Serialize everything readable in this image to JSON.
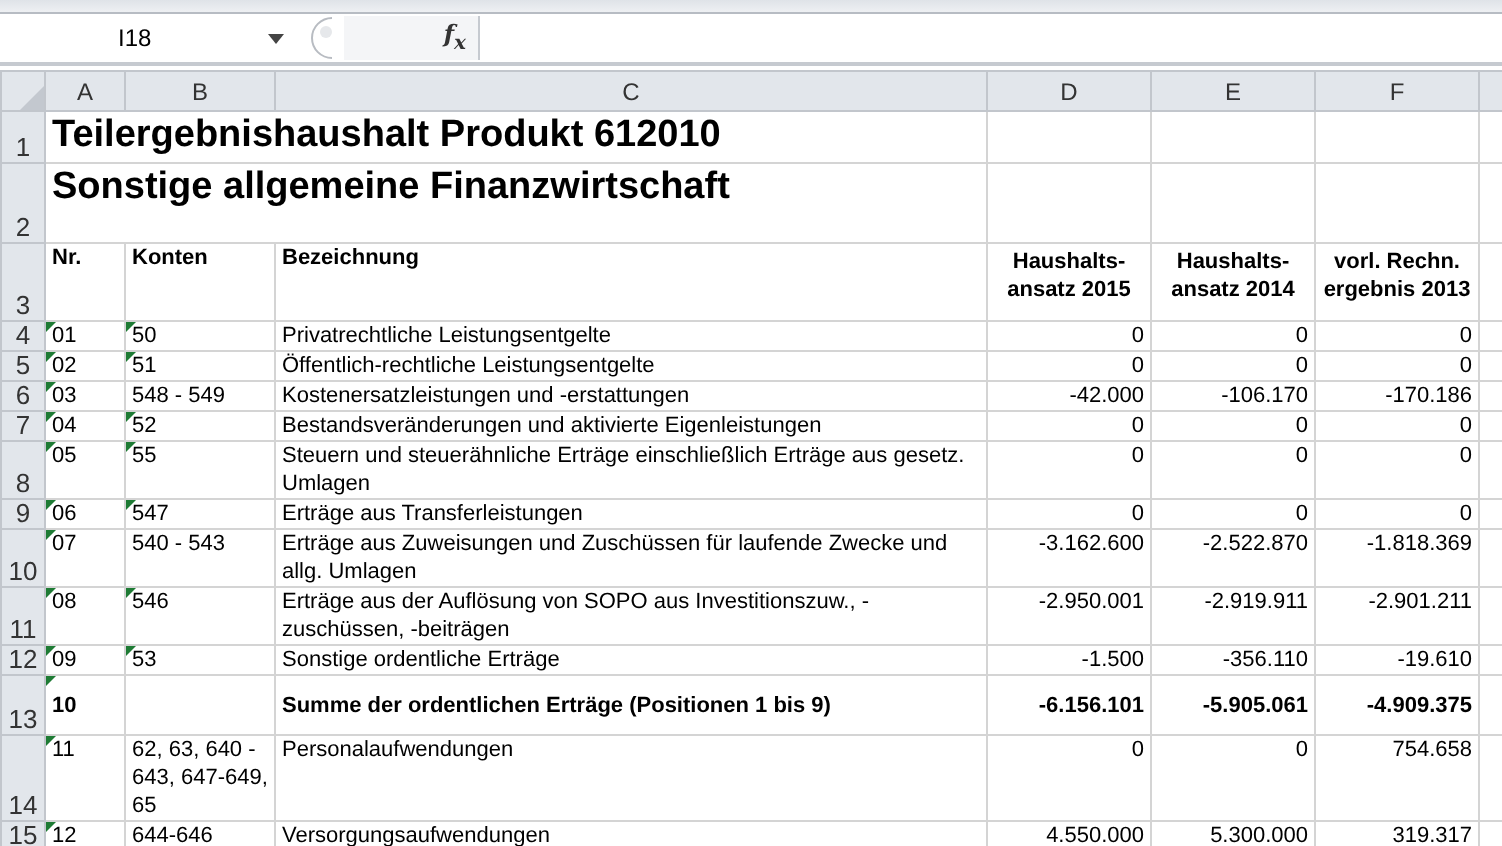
{
  "formula_bar": {
    "name_box": "I18",
    "function_label": "f$_{x}$"
  },
  "columns": [
    "A",
    "B",
    "C",
    "D",
    "E",
    "F"
  ],
  "rows": [
    {
      "row": "1",
      "kind": "title",
      "text": "Teilergebnishaushalt Produkt 612010"
    },
    {
      "row": "2",
      "kind": "title",
      "text": "Sonstige allgemeine Finanzwirtschaft"
    },
    {
      "row": "3",
      "kind": "header",
      "nr": "Nr.",
      "konten": "Konten",
      "bezeichnung": "Bezeichnung",
      "d": "Haushalts-\nansatz 2015",
      "e": "Haushalts-\nansatz 2014",
      "f": "vorl. Rechn.\nergebnis 2013"
    },
    {
      "row": "4",
      "kind": "data",
      "nr": "01",
      "nr_flag": true,
      "konten": "50",
      "konten_flag": true,
      "bezeichnung": "Privatrechtliche Leistungsentgelte",
      "d": "0",
      "e": "0",
      "f": "0"
    },
    {
      "row": "5",
      "kind": "data",
      "nr": "02",
      "nr_flag": true,
      "konten": "51",
      "konten_flag": true,
      "bezeichnung": "Öffentlich-rechtliche Leistungsentgelte",
      "d": "0",
      "e": "0",
      "f": "0"
    },
    {
      "row": "6",
      "kind": "data",
      "nr": "03",
      "nr_flag": true,
      "konten": "548 - 549",
      "konten_flag": false,
      "bezeichnung": "Kostenersatzleistungen und -erstattungen",
      "d": "-42.000",
      "e": "-106.170",
      "f": "-170.186"
    },
    {
      "row": "7",
      "kind": "data",
      "nr": "04",
      "nr_flag": true,
      "konten": "52",
      "konten_flag": true,
      "bezeichnung": "Bestandsveränderungen und aktivierte Eigenleistungen",
      "d": "0",
      "e": "0",
      "f": "0"
    },
    {
      "row": "8",
      "kind": "data",
      "nr": "05",
      "nr_flag": true,
      "konten": "55",
      "konten_flag": true,
      "bezeichnung": "Steuern und steuerähnliche Erträge einschließlich Erträge aus gesetz. Umlagen",
      "d": "0",
      "e": "0",
      "f": "0"
    },
    {
      "row": "9",
      "kind": "data",
      "nr": "06",
      "nr_flag": true,
      "konten": "547",
      "konten_flag": true,
      "bezeichnung": "Erträge aus Transferleistungen",
      "d": "0",
      "e": "0",
      "f": "0"
    },
    {
      "row": "10",
      "kind": "data",
      "nr": "07",
      "nr_flag": true,
      "konten": "540 - 543",
      "konten_flag": false,
      "bezeichnung": "Erträge aus Zuweisungen und Zuschüssen für laufende Zwecke und allg. Umlagen",
      "d": "-3.162.600",
      "e": "-2.522.870",
      "f": "-1.818.369"
    },
    {
      "row": "11",
      "kind": "data",
      "nr": "08",
      "nr_flag": true,
      "konten": "546",
      "konten_flag": true,
      "bezeichnung": "Erträge aus der Auflösung von SOPO aus Investitionszuw., -zuschüssen, -beiträgen",
      "d": "-2.950.001",
      "e": "-2.919.911",
      "f": "-2.901.211"
    },
    {
      "row": "12",
      "kind": "data",
      "nr": "09",
      "nr_flag": true,
      "konten": "53",
      "konten_flag": true,
      "bezeichnung": "Sonstige ordentliche Erträge",
      "d": "-1.500",
      "e": "-356.110",
      "f": "-19.610"
    },
    {
      "row": "13",
      "kind": "sum",
      "nr": "10",
      "nr_flag": true,
      "konten": "",
      "konten_flag": false,
      "bezeichnung": "Summe der ordentlichen Erträge (Positionen 1 bis 9)",
      "d": "-6.156.101",
      "e": "-5.905.061",
      "f": "-4.909.375"
    },
    {
      "row": "14",
      "kind": "data",
      "nr": "11",
      "nr_flag": true,
      "konten": "62, 63, 640 - 643, 647-649, 65",
      "konten_flag": false,
      "bezeichnung": "Personalaufwendungen",
      "d": "0",
      "e": "0",
      "f": "754.658"
    },
    {
      "row": "15",
      "kind": "data",
      "nr": "12",
      "nr_flag": true,
      "konten": "644-646",
      "konten_flag": false,
      "bezeichnung": "Versorgungsaufwendungen",
      "d": "4.550.000",
      "e": "5.300.000",
      "f": "319.317"
    }
  ]
}
